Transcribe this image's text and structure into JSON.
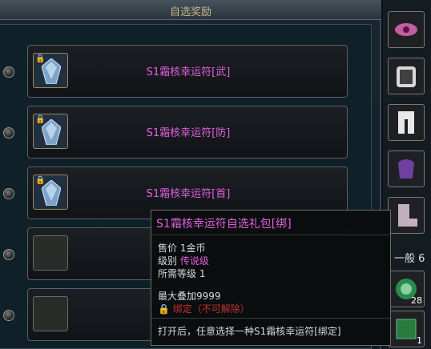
{
  "window": {
    "title": "自选奖励"
  },
  "rows": [
    {
      "name": "S1霜核幸运符[武]",
      "has_item": true
    },
    {
      "name": "S1霜核幸运符[防]",
      "has_item": true
    },
    {
      "name": "S1霜核幸运符[首]",
      "has_item": true
    },
    {
      "name": "",
      "has_item": false
    },
    {
      "name": "",
      "has_item": false
    }
  ],
  "sidebar": {
    "tab_label": "一般 6",
    "stack_count_1": "28",
    "stack_count_2": "1"
  },
  "tooltip": {
    "title": "S1霜核幸运符自选礼包[绑]",
    "price_label": "售价",
    "price_value": "1金币",
    "grade_label": "级别",
    "grade_value": "传说级",
    "level_label": "所需等级",
    "level_value": "1",
    "stack_label": "最大叠加",
    "stack_value": "9999",
    "bind_text": "绑定（不可解除）",
    "desc": "打开后，任意选择一种S1霜核幸运符[绑定]"
  },
  "colors": {
    "item_name": "#e060e0",
    "bind_red": "#c03030"
  }
}
